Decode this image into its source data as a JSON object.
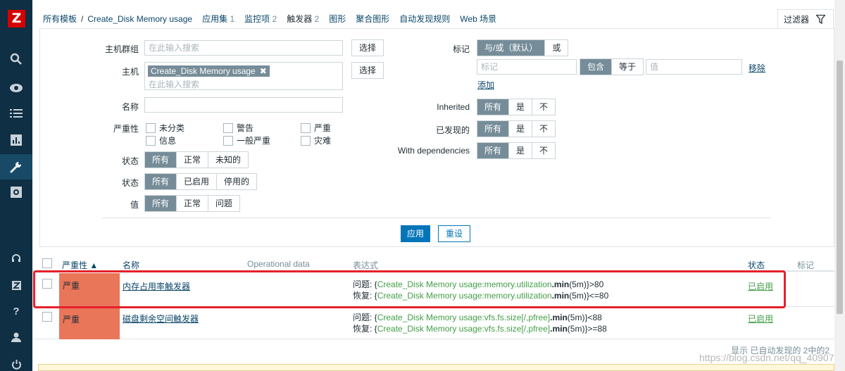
{
  "app": {
    "logo": "Z"
  },
  "breadcrumb": {
    "all_templates": "所有模板",
    "template": "Create_Disk Memory usage",
    "applications": "应用集",
    "applications_count": "1",
    "items": "监控项",
    "items_count": "2",
    "triggers": "触发器",
    "triggers_count": "2",
    "graphs": "图形",
    "screens": "聚合图形",
    "discovery": "自动发现规则",
    "web": "Web 场景"
  },
  "filter_tab": {
    "label": "过滤器",
    "icon": "funnel-icon"
  },
  "filter": {
    "host_group_label": "主机群组",
    "host_group_placeholder": "在此输入搜索",
    "select_label": "选择",
    "host_label": "主机",
    "host_tag": "Create_Disk Memory usage",
    "host_placeholder": "在此输入搜索",
    "name_label": "名称",
    "severity_label": "严重性",
    "severities": [
      "未分类",
      "警告",
      "严重",
      "信息",
      "一般严重",
      "灾难"
    ],
    "state_label": "状态",
    "state_options": [
      "所有",
      "正常",
      "未知的"
    ],
    "status_label": "状态",
    "status_options": [
      "所有",
      "已启用",
      "停用的"
    ],
    "value_label": "值",
    "value_options": [
      "所有",
      "正常",
      "问题"
    ],
    "tags_label": "标记",
    "tags_mode": [
      "与/或（默认）",
      "或"
    ],
    "tag_placeholder": "标记",
    "tag_operators": [
      "包含",
      "等于"
    ],
    "value_placeholder": "值",
    "remove_link": "移除",
    "add_link": "添加",
    "inherited_label": "Inherited",
    "discovered_label": "已发现的",
    "dependencies_label": "With dependencies",
    "tri_options": [
      "所有",
      "是",
      "不"
    ],
    "apply_label": "应用",
    "reset_label": "重设"
  },
  "table": {
    "headers": {
      "severity": "严重性 ▲",
      "name": "名称",
      "opdata": "Operational data",
      "expression": "表达式",
      "status": "状态",
      "tags": "标记"
    },
    "rows": [
      {
        "severity": "严重",
        "name": "内存占用率触发器",
        "problem_prefix": "问题: ",
        "problem_open": "{",
        "problem_key": "Create_Disk Memory usage:memory.utilization",
        "problem_func": ".min",
        "problem_tail": "(5m)}>80",
        "recovery_prefix": "恢复: ",
        "recovery_open": "{",
        "recovery_key": "Create_Disk Memory usage:memory.utilization",
        "recovery_func": ".min",
        "recovery_tail": "(5m)}<=80",
        "status": "已启用"
      },
      {
        "severity": "严重",
        "name": "磁盘剩余空间触发器",
        "problem_prefix": "问题: ",
        "problem_open": "{",
        "problem_key": "Create_Disk Memory usage:vfs.fs.size[/,pfree]",
        "problem_func": ".min",
        "problem_tail": "(5m)}<88",
        "recovery_prefix": "恢复: ",
        "recovery_open": "{",
        "recovery_key": "Create_Disk Memory usage:vfs.fs.size[/,pfree]",
        "recovery_func": ".min",
        "recovery_tail": "(5m)}>=88",
        "status": "已启用"
      }
    ],
    "footer": "显示 已自动发现的 2中的2"
  },
  "watermark": "https://blog.csdn.net/qq_40907977",
  "colors": {
    "sidebar": "#0e2f44",
    "accent": "#0275b8",
    "severity_high": "#e97659",
    "enabled": "#429e47",
    "highlight": "#e5202b"
  }
}
